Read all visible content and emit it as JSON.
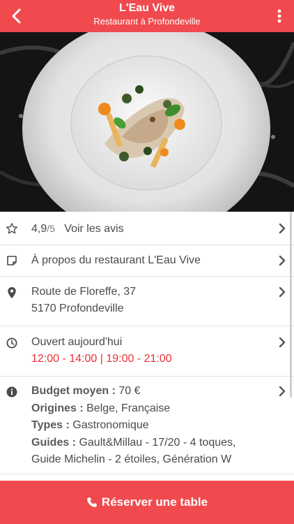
{
  "header": {
    "title": "L'Eau Vive",
    "subtitle": "Restaurant à Profondeville"
  },
  "rating": {
    "value": "4,9",
    "scale": "/5",
    "reviews_link": "Voir les avis"
  },
  "about": {
    "label": "À propos du restaurant L'Eau Vive"
  },
  "address": {
    "line1": "Route de Floreffe, 37",
    "line2": "5170 Profondeville"
  },
  "hours": {
    "status": "Ouvert aujourd'hui",
    "times": "12:00 - 14:00 | 19:00 - 21:00"
  },
  "info": {
    "budget_label": "Budget moyen :",
    "budget_value": " 70 €",
    "origins_label": "Origines :",
    "origins_value": " Belge, Française",
    "types_label": "Types :",
    "types_value": " Gastronomique",
    "guides_label": "Guides :",
    "guides_value": " Gault&Millau - 17/20 - 4 toques,",
    "guides_value_line2": "Guide Michelin - 2 étoiles, Génération W"
  },
  "cta": {
    "label": "Réserver une table"
  },
  "colors": {
    "brand_red": "#f04a4f",
    "hours_red": "#e8323a"
  },
  "icons": [
    "back-arrow-icon",
    "more-vertical-icon",
    "star-icon",
    "note-icon",
    "map-pin-icon",
    "clock-icon",
    "info-icon",
    "chevron-right-icon",
    "phone-icon"
  ]
}
